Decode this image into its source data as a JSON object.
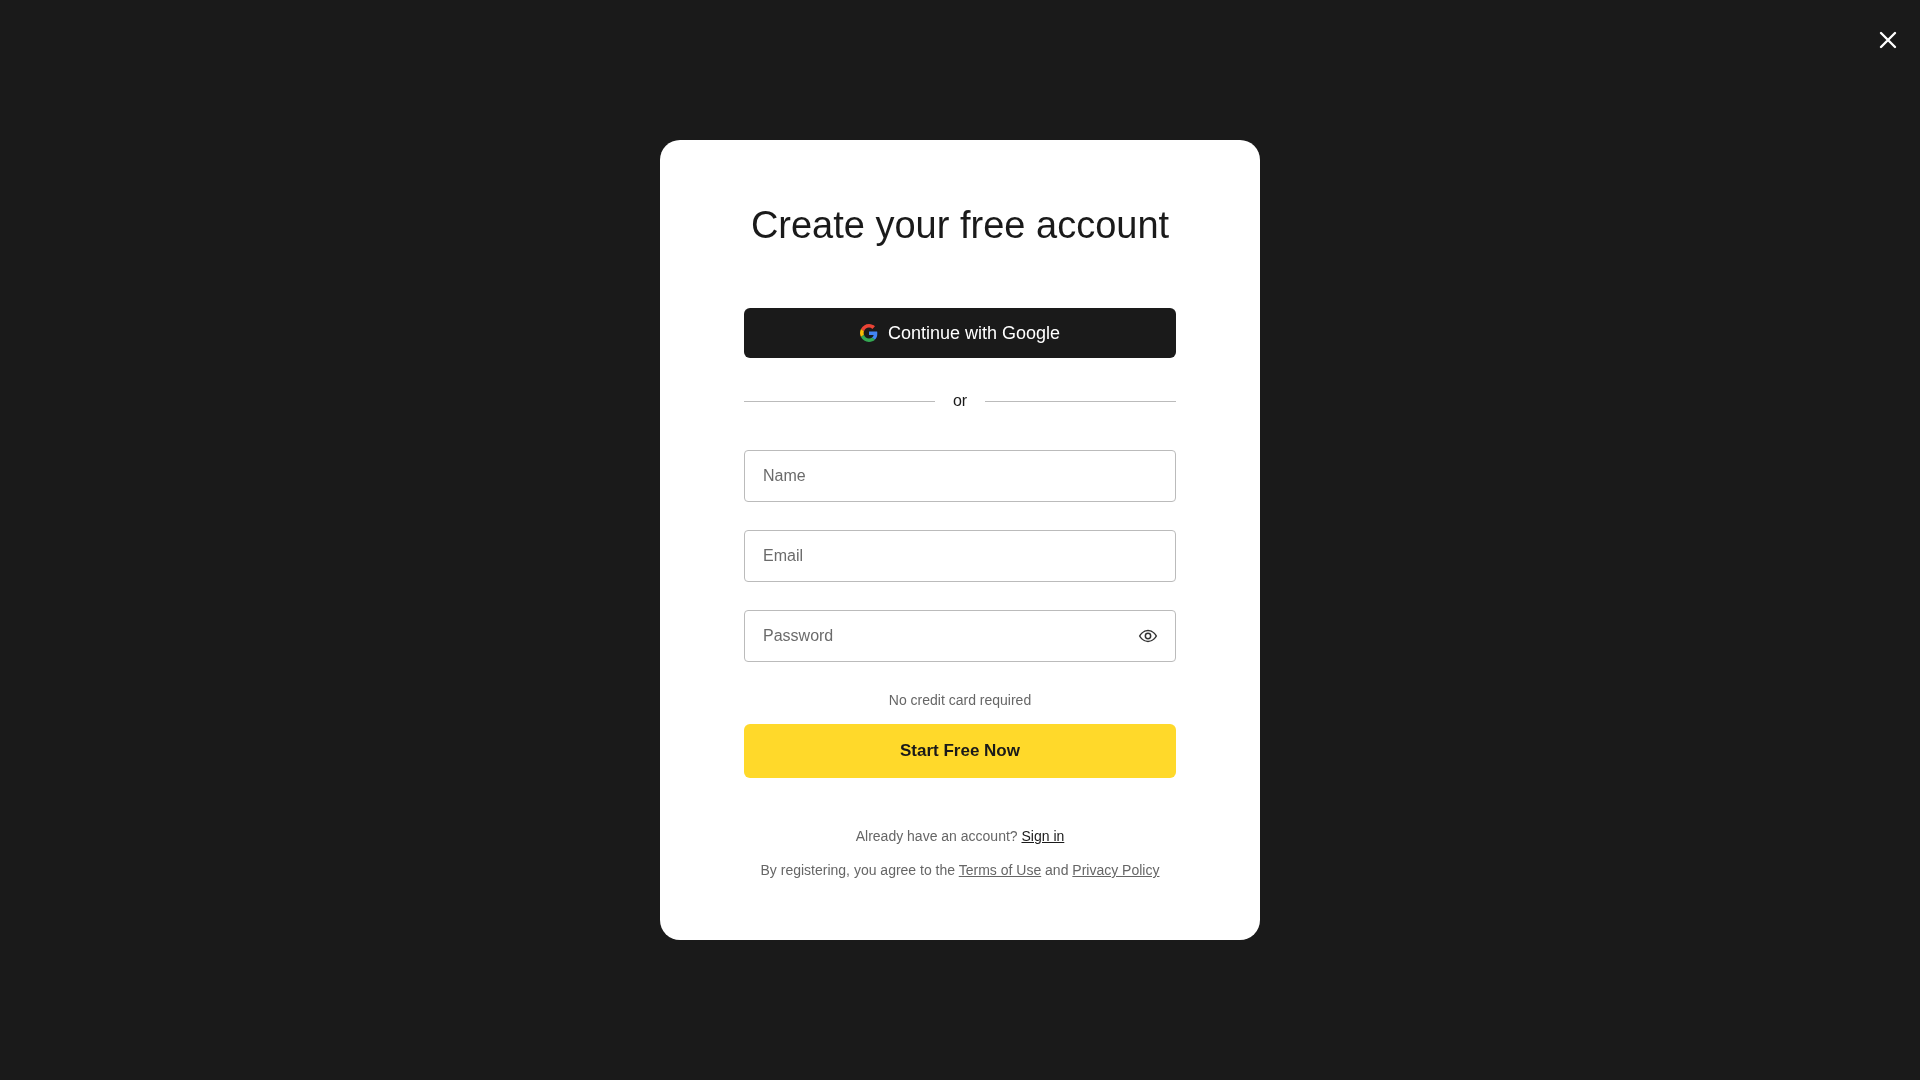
{
  "title": "Create your free account",
  "google_button": {
    "label": "Continue with Google"
  },
  "divider": {
    "label": "or"
  },
  "fields": [
    {
      "kind": "text",
      "placeholder": "Name"
    },
    {
      "kind": "email",
      "placeholder": "Email"
    },
    {
      "kind": "password",
      "placeholder": "Password"
    }
  ],
  "note": "No credit card required",
  "submit_button": {
    "label": "Start Free Now"
  },
  "sign_in": {
    "text": "Already have an account?",
    "link": "Sign in"
  },
  "legal": {
    "text": "By registering, you agree to the",
    "link_1": "Terms of Use",
    "joiner": "and",
    "link_2": "Privacy Policy"
  }
}
